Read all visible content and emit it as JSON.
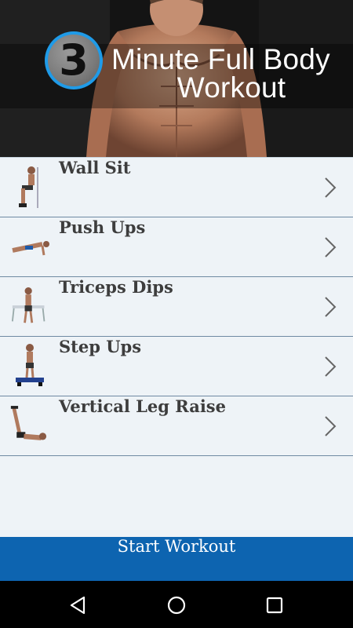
{
  "header": {
    "badge_number": "3",
    "title_line1": "Minute Full Body",
    "title_line2": "Workout"
  },
  "exercises": [
    {
      "label": "Wall Sit",
      "icon": "wall-sit-figure"
    },
    {
      "label": "Push Ups",
      "icon": "push-up-figure"
    },
    {
      "label": "Triceps Dips",
      "icon": "triceps-dips-figure"
    },
    {
      "label": "Step Ups",
      "icon": "step-ups-figure"
    },
    {
      "label": "Vertical Leg Raise",
      "icon": "leg-raise-figure"
    }
  ],
  "start_button": {
    "label": "Start Workout"
  },
  "nav": {
    "back": "back-icon",
    "home": "home-icon",
    "recents": "recents-icon"
  },
  "colors": {
    "accent": "#0d64b0",
    "badge_ring": "#1f9be8",
    "list_bg": "#eef3f7"
  }
}
